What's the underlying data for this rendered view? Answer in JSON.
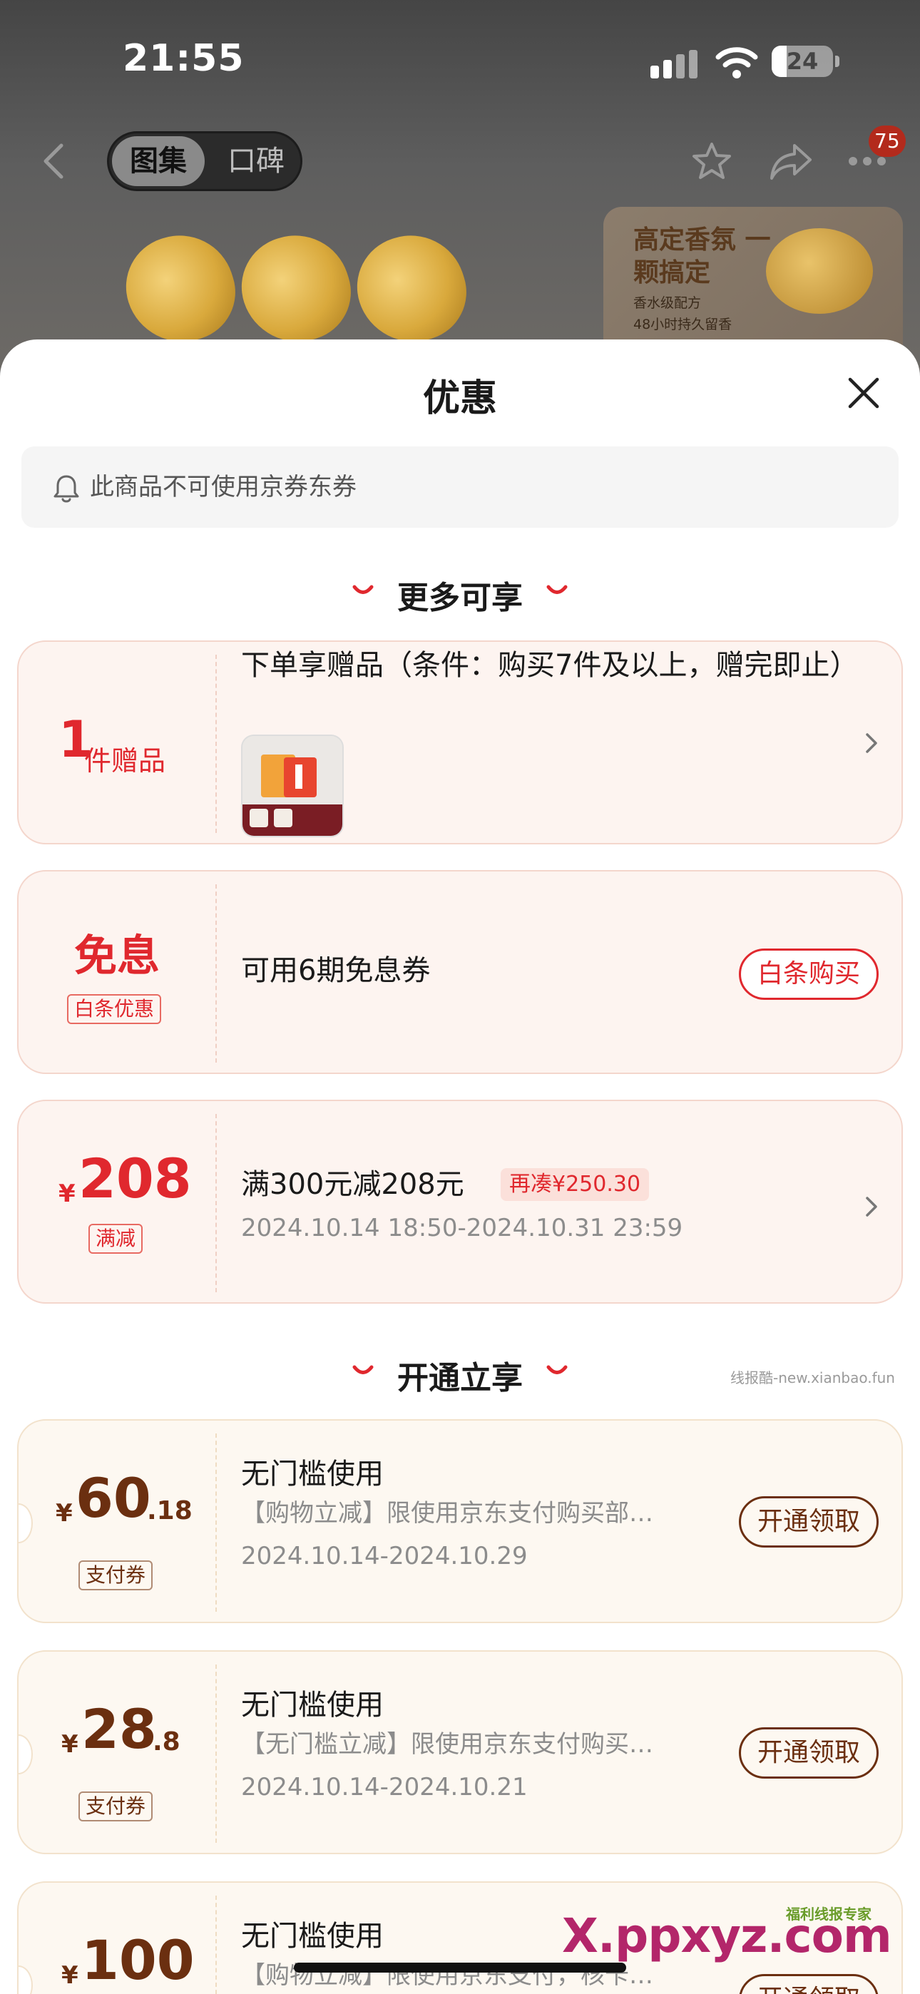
{
  "status_bar": {
    "time": "21:55",
    "battery": "24",
    "battery_level": 0.24
  },
  "nav": {
    "tabs": [
      "图集",
      "口碑"
    ],
    "active_tab": 0,
    "notification_count": "75"
  },
  "banner": {
    "promo_title": "高定香氛 一颗搞定",
    "features": [
      "香水级配方",
      "48小时持久留香"
    ]
  },
  "sheet": {
    "title": "优惠",
    "notice": "此商品不可使用京券东券"
  },
  "sections": {
    "more": "更多可享",
    "open": "开通立享",
    "watermark": "线报酷-new.xianbao.fun"
  },
  "gift_card": {
    "count": "1",
    "unit": "件赠品",
    "title": "下单享赠品（条件：购买7件及以上，赠完即止）"
  },
  "interest_card": {
    "big": "免息",
    "tag": "白条优惠",
    "title": "可用6期免息券",
    "button": "白条购买"
  },
  "discount_card": {
    "currency": "¥",
    "amount": "208",
    "tag": "满减",
    "title": "满300元减208元",
    "pill": "再凑¥250.30",
    "validity": "2024.10.14 18:50-2024.10.31 23:59"
  },
  "pay_coupons": [
    {
      "currency": "¥",
      "amount": "60",
      "decimal": ".18",
      "tag": "支付券",
      "title": "无门槛使用",
      "desc": "【购物立减】限使用京东支付购买部…",
      "validity": "2024.10.14-2024.10.29",
      "button": "开通领取"
    },
    {
      "currency": "¥",
      "amount": "28",
      "decimal": ".8",
      "tag": "支付券",
      "title": "无门槛使用",
      "desc": "【无门槛立减】限使用京东支付购买…",
      "validity": "2024.10.14-2024.10.21",
      "button": "开通领取"
    },
    {
      "currency": "¥",
      "amount": "100",
      "decimal": "",
      "tag": "",
      "title": "无门槛使用",
      "desc": "【购物立减】限使用京东支付，核卡…",
      "validity": "",
      "button": "开通领取"
    }
  ],
  "watermarks": {
    "brand": "X.ppxyz.com",
    "small": "福利线报专家"
  },
  "colors": {
    "accent_red": "#e0282e",
    "brown": "#6b2f10",
    "overlay": "#6b6b6b"
  }
}
